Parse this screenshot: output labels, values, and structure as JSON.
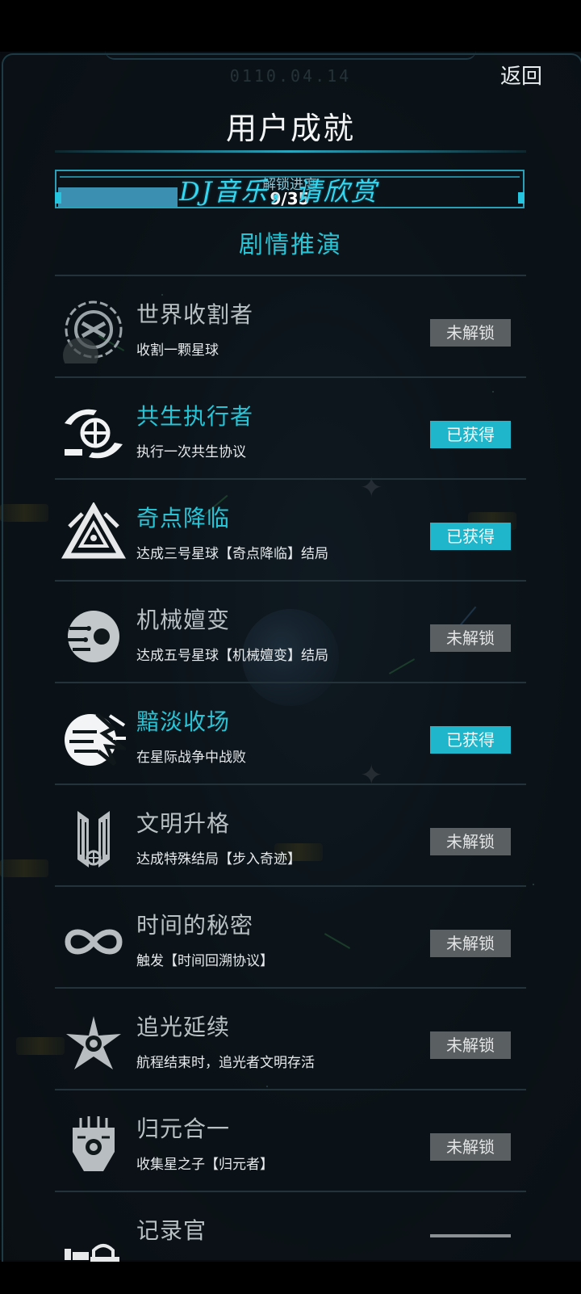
{
  "header": {
    "date": "0110.04.14",
    "back_label": "返回",
    "title": "用户成就"
  },
  "progress": {
    "label": "解锁进度",
    "count_text": "9/35",
    "unlocked": 9,
    "total": 35,
    "watermark": "DJ音乐，请欣赏"
  },
  "section": {
    "title": "剧情推演"
  },
  "colors": {
    "accent": "#27c4d6",
    "badge_obtained": "#1fb6cb",
    "badge_locked": "#5a5f61"
  },
  "achievements": [
    {
      "name": "世界收割者",
      "desc": "收割一颗星球",
      "status": "未解锁",
      "obtained": false,
      "icon": "planet-harvester-icon"
    },
    {
      "name": "共生执行者",
      "desc": "执行一次共生协议",
      "status": "已获得",
      "obtained": true,
      "icon": "symbiosis-hands-globe-icon"
    },
    {
      "name": "奇点降临",
      "desc": "达成三号星球【奇点降临】结局",
      "status": "已获得",
      "obtained": true,
      "icon": "singularity-triangle-icon"
    },
    {
      "name": "机械嬗变",
      "desc": "达成五号星球【机械嬗变】结局",
      "status": "未解锁",
      "obtained": false,
      "icon": "mechanical-eye-icon"
    },
    {
      "name": "黯淡收场",
      "desc": "在星际战争中战败",
      "status": "已获得",
      "obtained": true,
      "icon": "shattered-planet-icon"
    },
    {
      "name": "文明升格",
      "desc": "达成特殊结局【步入奇迹】",
      "status": "未解锁",
      "obtained": false,
      "icon": "winged-emblem-icon"
    },
    {
      "name": "时间的秘密",
      "desc": "触发【时间回溯协议】",
      "status": "未解锁",
      "obtained": false,
      "icon": "infinity-icon"
    },
    {
      "name": "追光延续",
      "desc": "航程结束时，追光者文明存活",
      "status": "未解锁",
      "obtained": false,
      "icon": "radiant-star-icon"
    },
    {
      "name": "归元合一",
      "desc": "收集星之子【归元者】",
      "status": "未解锁",
      "obtained": false,
      "icon": "circuit-mask-icon"
    },
    {
      "name": "记录官",
      "desc": "",
      "status": "",
      "obtained": false,
      "icon": "recorder-device-icon"
    }
  ]
}
